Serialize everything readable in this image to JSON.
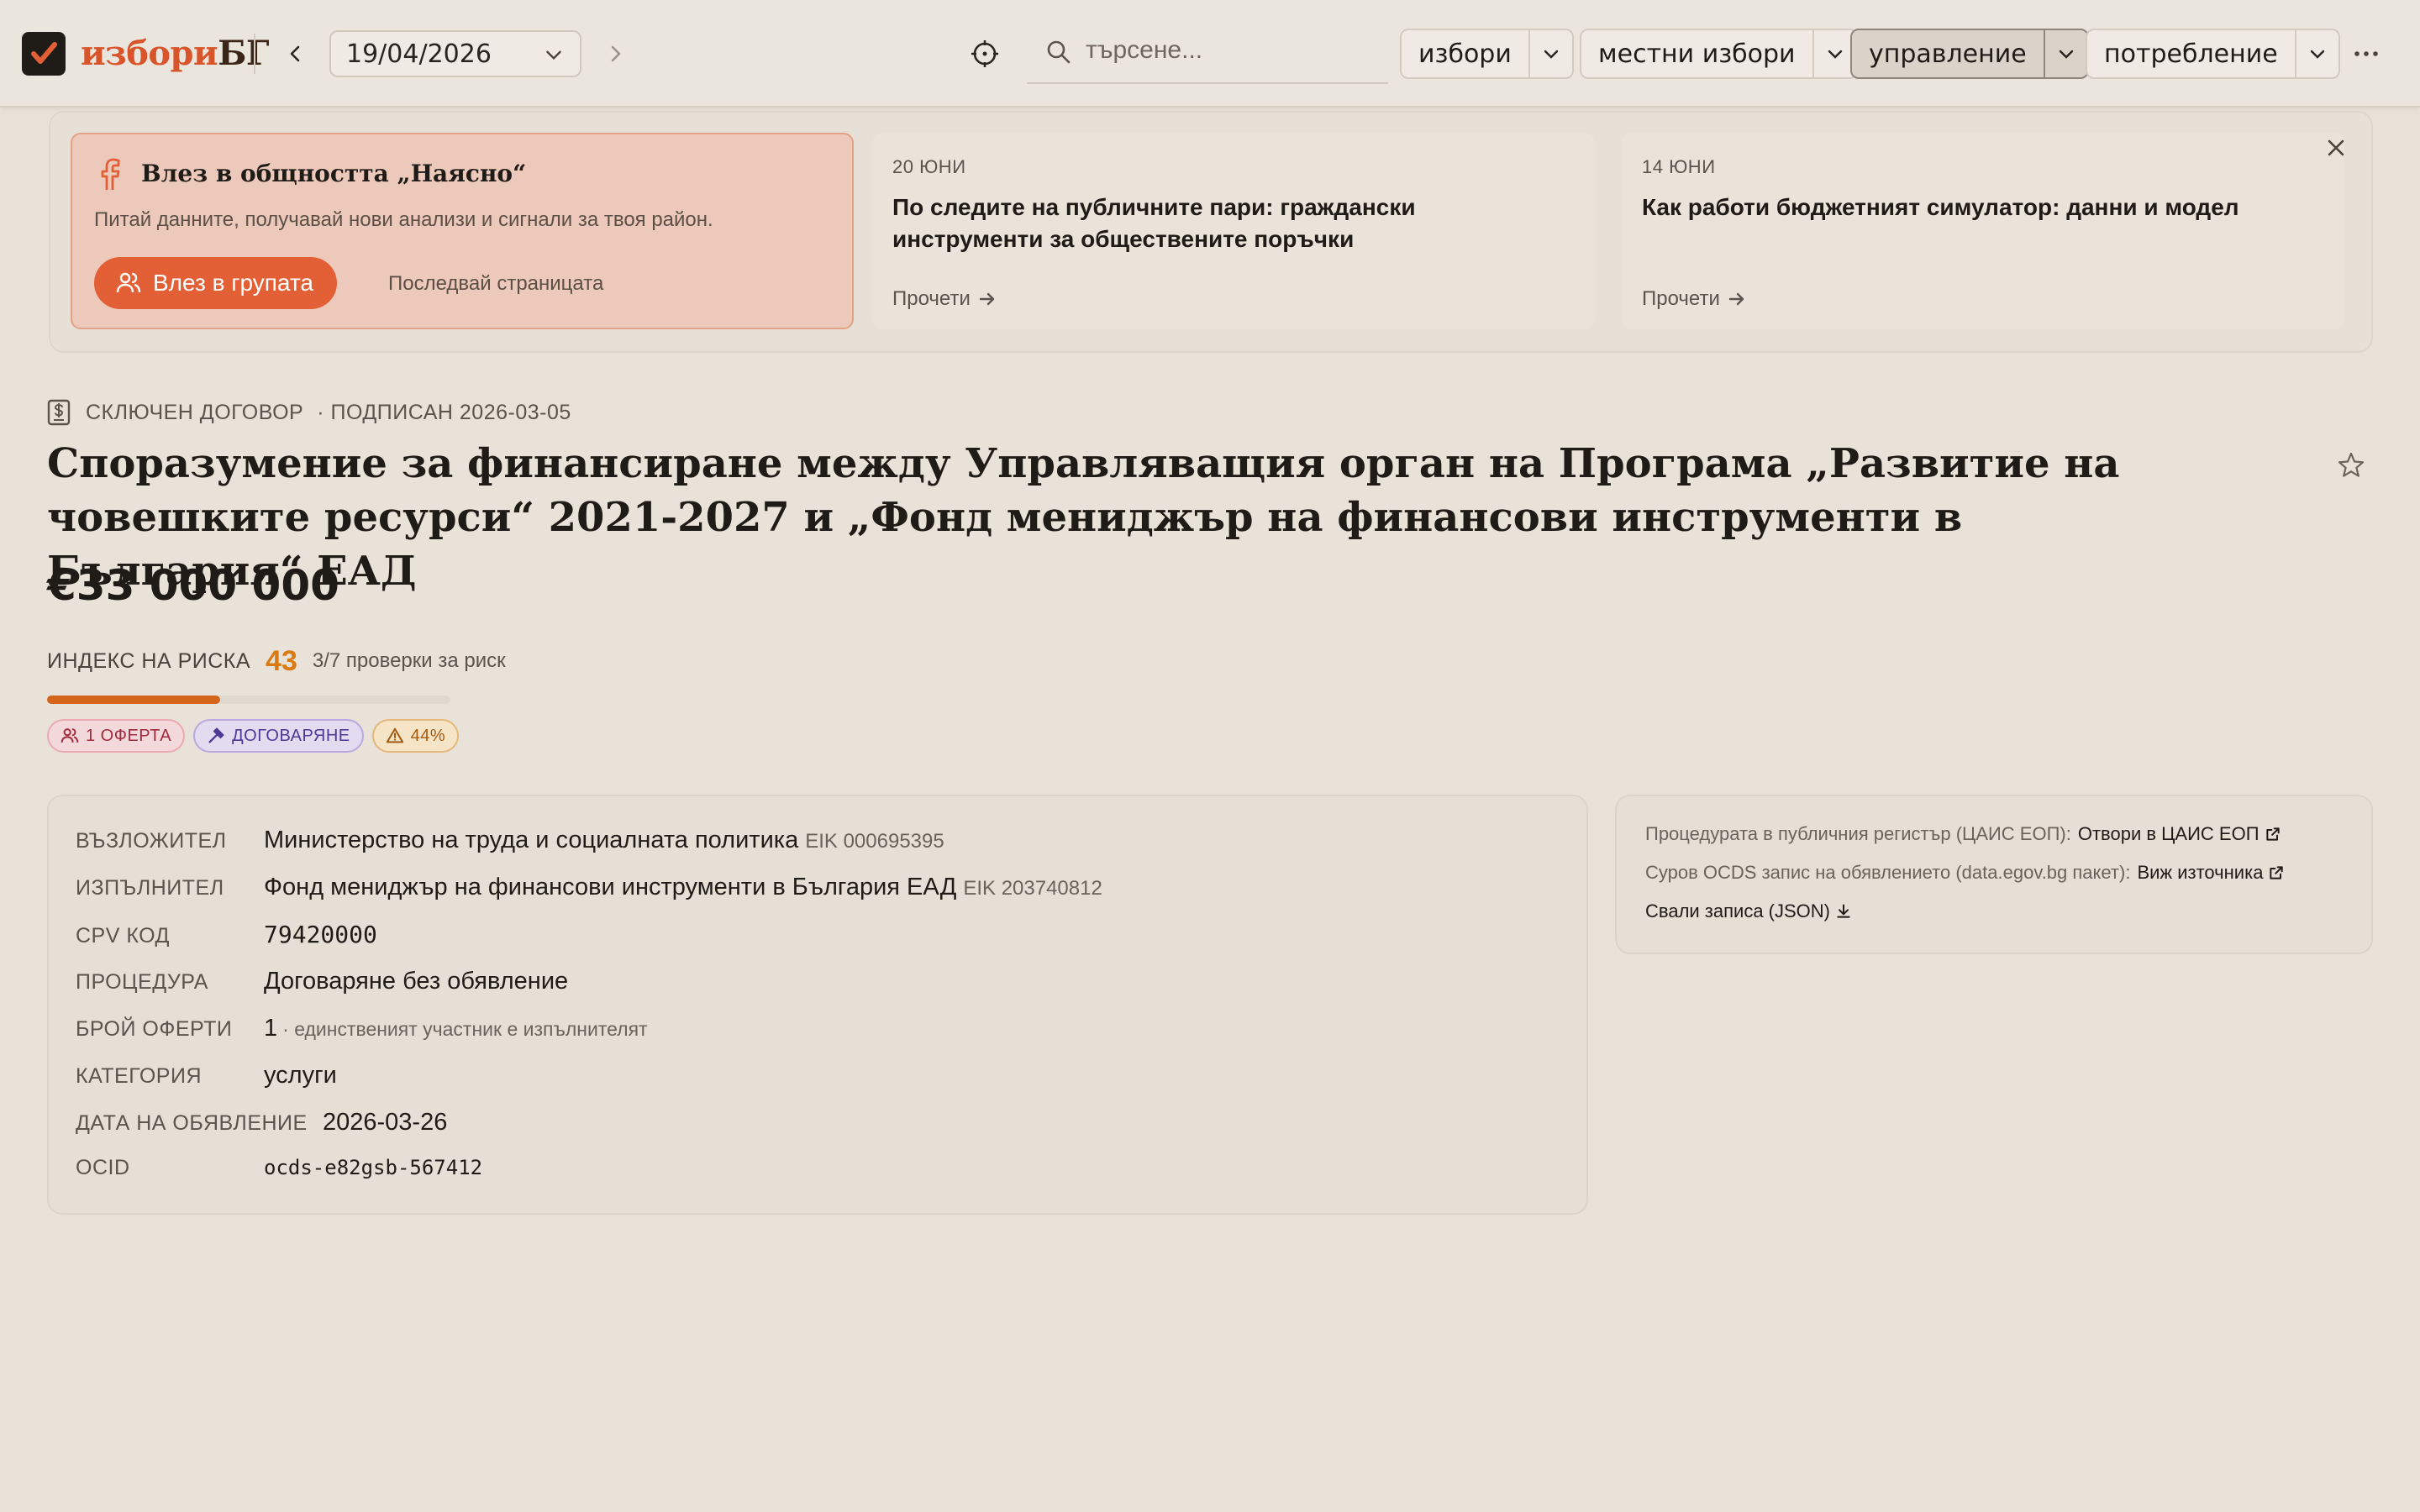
{
  "header": {
    "logo_part1": "избори",
    "logo_part2": "БГ",
    "date": "19/04/2026",
    "search_placeholder": "търсене...",
    "menus": [
      {
        "label": "избори",
        "active": false
      },
      {
        "label": "местни избори",
        "active": false
      },
      {
        "label": "управление",
        "active": true
      },
      {
        "label": "потребление",
        "active": false
      }
    ],
    "icons": [
      "check-logo-icon",
      "chevron-left-icon",
      "chevron-right-icon",
      "chevron-down-icon",
      "crosshair-icon",
      "search-icon",
      "more-horizontal-icon"
    ]
  },
  "promo": {
    "community": {
      "title": "Влез в общността „Наясно“",
      "subtitle": "Питай данните, получавай нови анализи и сигнали за твоя район.",
      "join_label": "Влез в групата",
      "follow_label": "Последвай страницата"
    },
    "articles": [
      {
        "date": "20 ЮНИ",
        "headline": "По следите на публичните пари: граждански инструменти за обществените поръчки",
        "read_label": "Прочети"
      },
      {
        "date": "14 ЮНИ",
        "headline": "Как работи бюджетният симулатор: данни и модел",
        "read_label": "Прочети"
      }
    ]
  },
  "contract": {
    "type_label": "СКЛЮЧЕН ДОГОВОР",
    "signed_label": "· ПОДПИСАН 2026-03-05",
    "title": "Споразумение за финансиране между Управляващия орган на Програма „Развитие на човешките ресурси“ 2021-2027 и „Фонд мениджър на финансови инструменти в България“ ЕАД",
    "amount": "€33 000 000",
    "risk": {
      "label": "ИНДЕКС НА РИСКА",
      "score": "43",
      "score_fraction": 0.43,
      "checks": "3/7 проверки за риск"
    },
    "tags": [
      {
        "label": "1 ОФЕРТА",
        "icon": "users-icon"
      },
      {
        "label": "ДОГОВАРЯНЕ",
        "icon": "gavel-icon"
      },
      {
        "label": "44%",
        "icon": "warning-icon"
      }
    ],
    "accent_color": "#d97b12"
  },
  "details": {
    "buyer_label": "ВЪЗЛОЖИТЕЛ",
    "buyer": "Министерство на труда и социалната политика",
    "buyer_eik": "EIK 000695395",
    "supplier_label": "ИЗПЪЛНИТЕЛ",
    "supplier": "Фонд мениджър на финансови инструменти в България ЕАД",
    "supplier_eik": "EIK 203740812",
    "cpv_label": "CPV КОД",
    "cpv": "79420000",
    "procedure_label": "ПРОЦЕДУРА",
    "procedure": "Договаряне без обявление",
    "offers_label": "БРОЙ ОФЕРТИ",
    "offers": "1",
    "offers_note": "· единственият участник е изпълнителят",
    "category_label": "КАТЕГОРИЯ",
    "category": "услуги",
    "announce_label": "ДАТА НА ОБЯВЛЕНИЕ",
    "announce": "2026-03-26",
    "ocid_label": "OCID",
    "ocid": "ocds-e82gsb-567412"
  },
  "source": {
    "registry_label": "Процедурата в публичния регистър (ЦАИС ЕОП):",
    "registry_link": "Отвори в ЦАИС ЕОП",
    "raw_label": "Суров OCDS запис на обявлението (data.egov.bg пакет):",
    "raw_link": "Виж източника",
    "download_link": "Свали записа (JSON)"
  }
}
